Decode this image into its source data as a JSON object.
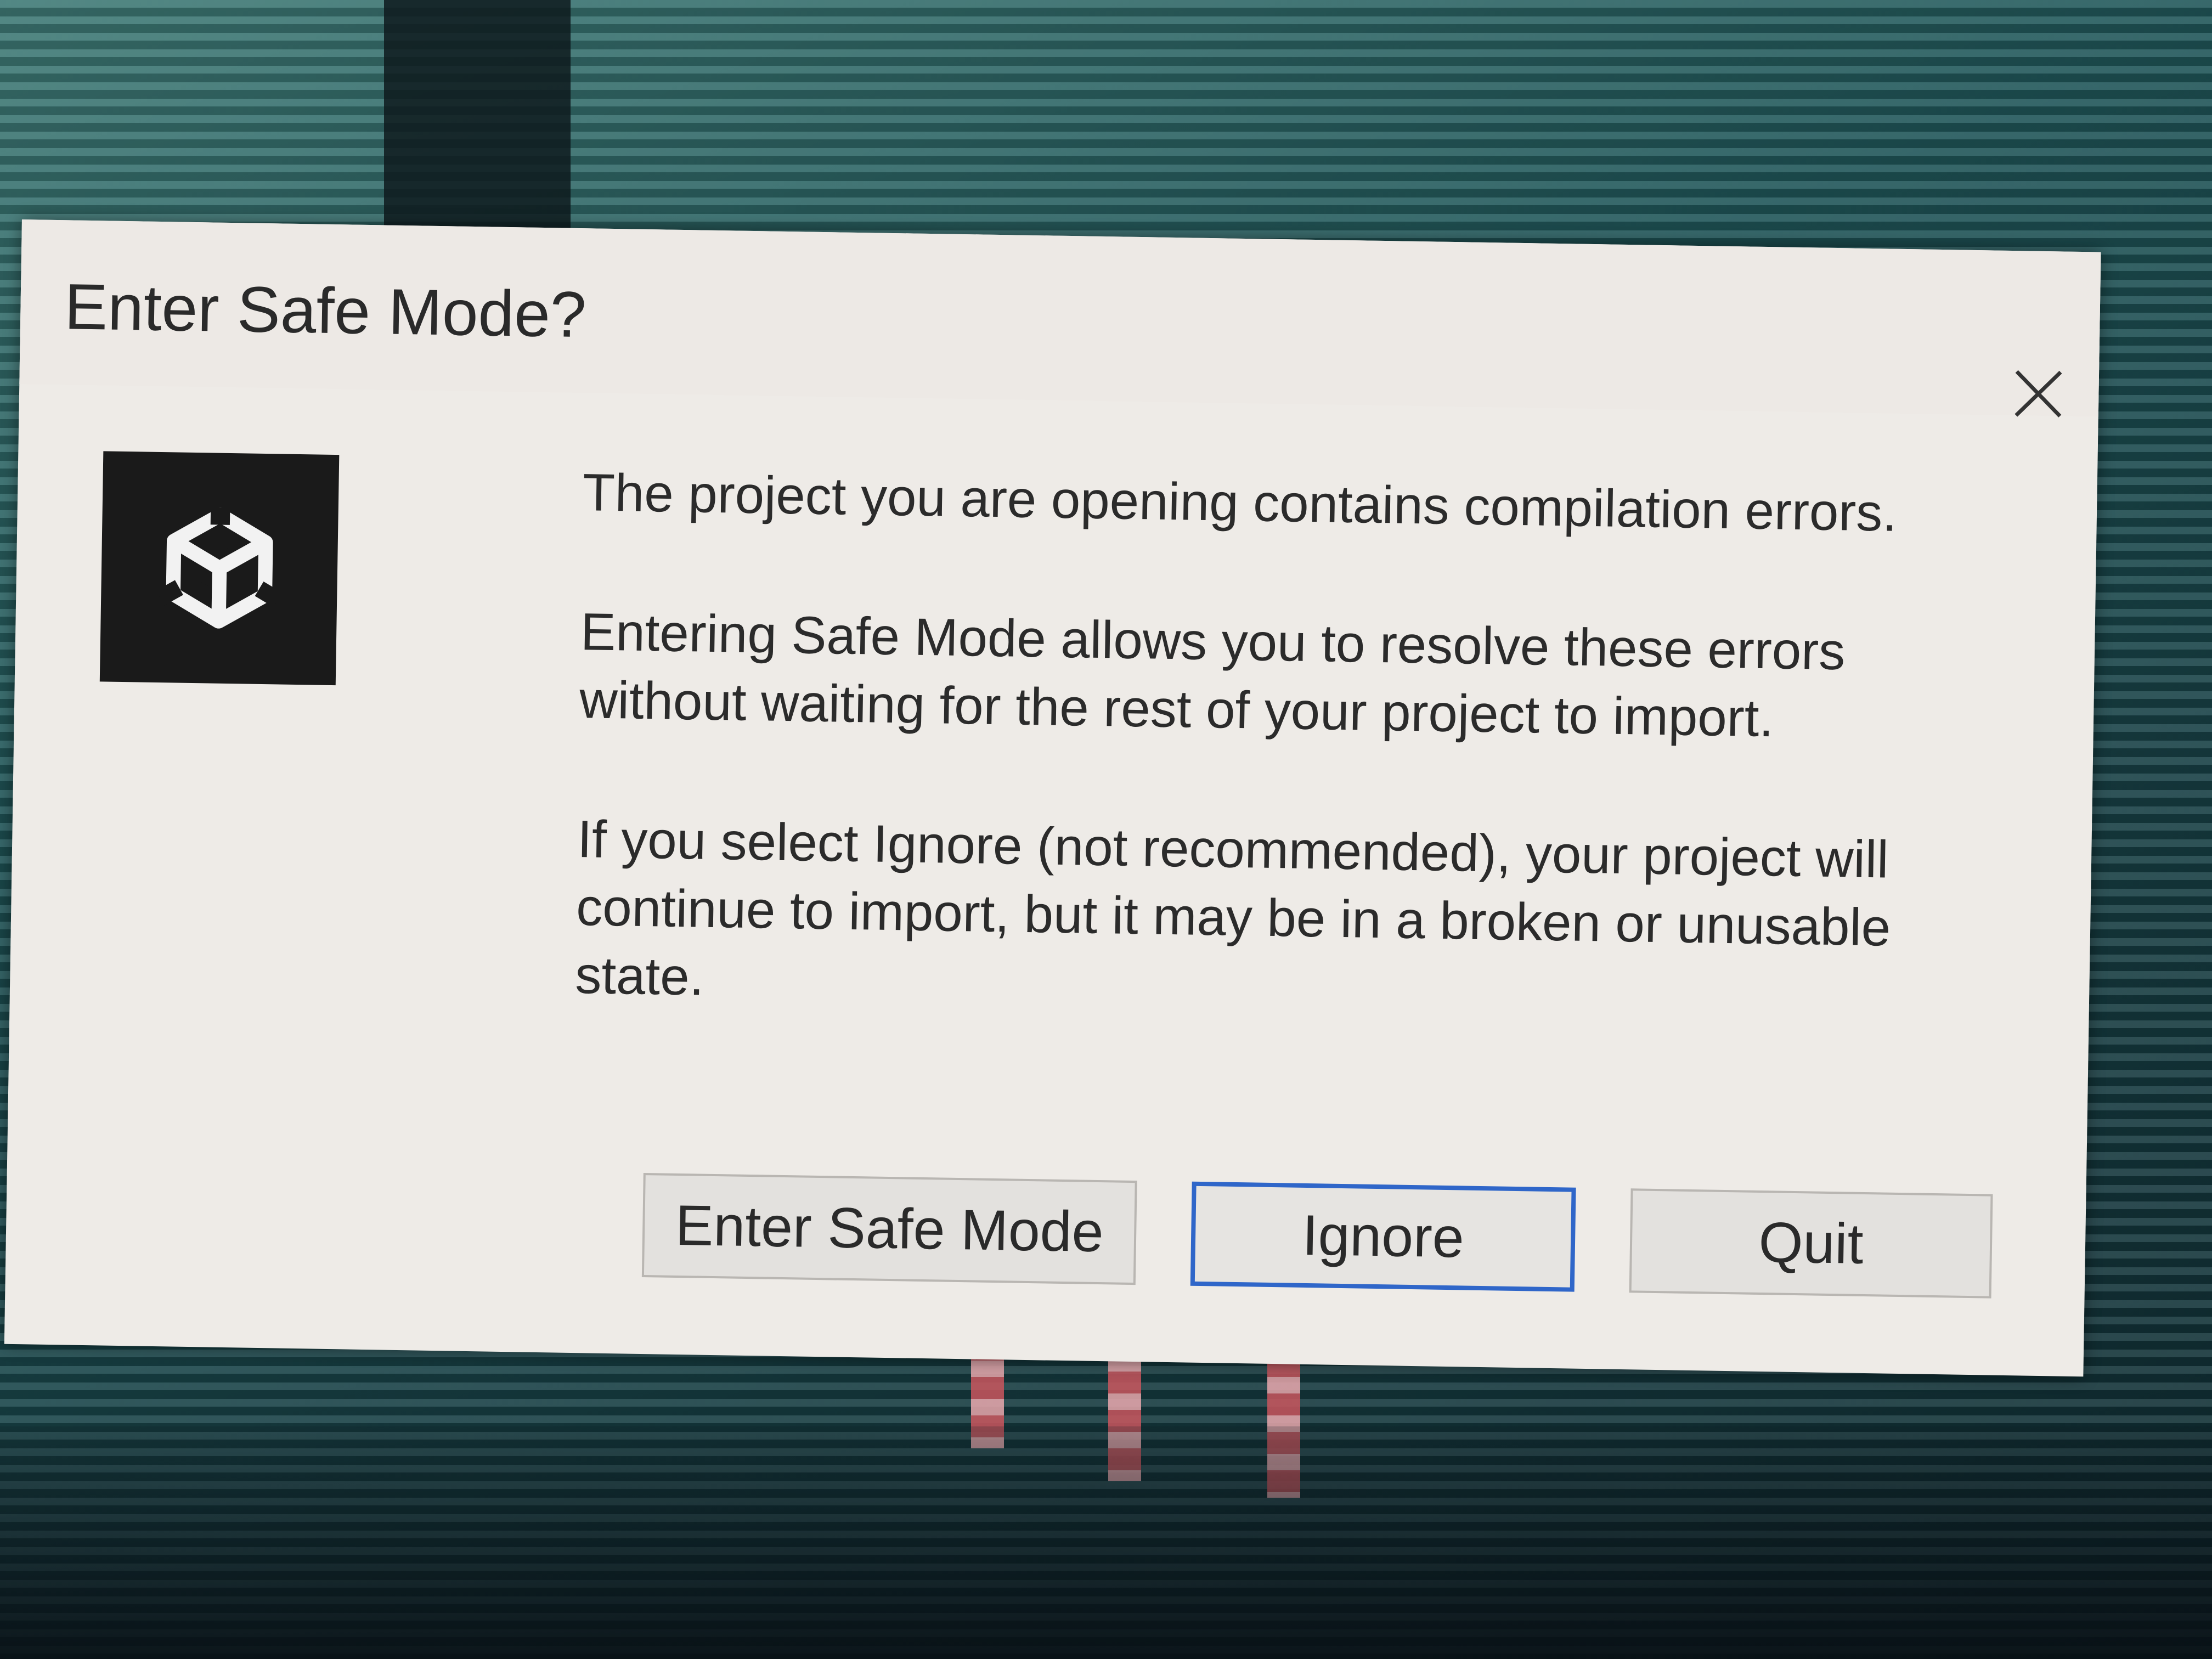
{
  "dialog": {
    "title": "Enter Safe Mode?",
    "close_icon": "close-icon",
    "app_icon": "unity-logo-icon",
    "paragraphs": [
      "The project you are opening contains compilation errors.",
      "Entering Safe Mode allows you to resolve these errors without waiting for the rest of your project to import.",
      "If you select Ignore (not recommended), your project will continue to import, but it may be in a broken or unusable state."
    ],
    "buttons": {
      "enter_safe_mode": "Enter Safe Mode",
      "ignore": "Ignore",
      "quit": "Quit"
    },
    "focused_button": "Ignore"
  },
  "colors": {
    "dialog_background": "#eeebe7",
    "focus_border": "#2f66c9",
    "logo_background": "#1a1a1a"
  }
}
